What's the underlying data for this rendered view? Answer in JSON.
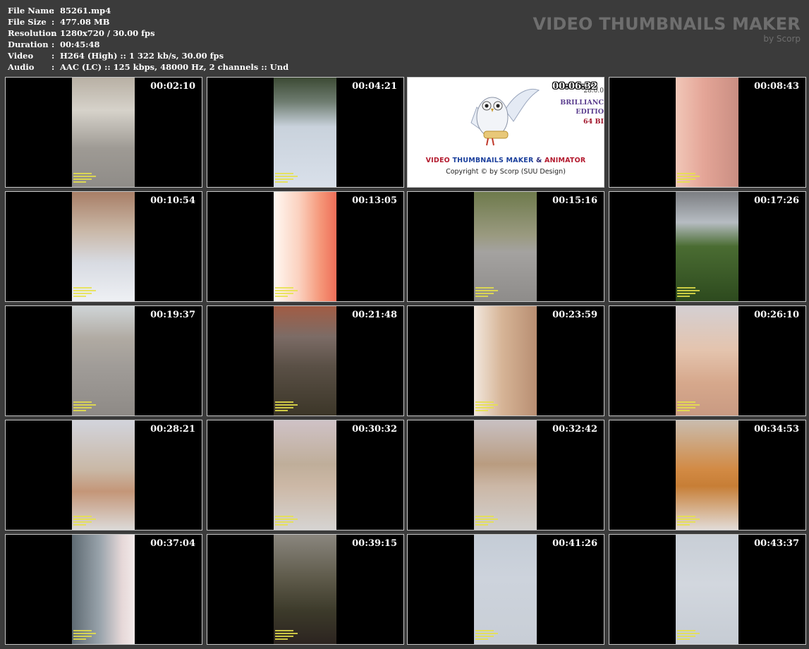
{
  "file_info": {
    "rows": [
      {
        "key": "File Name",
        "sep": ":",
        "value": "85261.mp4"
      },
      {
        "key": "File Size",
        "sep": ":",
        "value": "477.08 MB"
      },
      {
        "key": "Resolution",
        "sep": ":",
        "value": "1280x720 / 30.00 fps"
      },
      {
        "key": "Duration",
        "sep": ":",
        "value": "00:45:48"
      },
      {
        "key": "Video",
        "sep": ":",
        "value": "H264 (High) :: 1 322 kb/s, 30.00 fps"
      },
      {
        "key": "Audio",
        "sep": ":",
        "value": "AAC (LC) :: 125 kbps, 48000 Hz, 2 channels :: Und"
      }
    ]
  },
  "brand": {
    "title": "VIDEO THUMBNAILS MAKER",
    "subtitle": "by Scorp"
  },
  "splash": {
    "title_a": "VIDEO ",
    "title_b": "THUMBNAILS MAKER",
    "title_c": " & ",
    "title_d": "ANIMATOR",
    "copyright": "Copyright © by Scorp (SUU Design)",
    "version": "28.0.0",
    "edition_1": "BRILLIANC",
    "edition_2": "EDITIO",
    "edition_3": "64 BI"
  },
  "thumbnails": [
    {
      "time": "00:02:10",
      "bg": "linear-gradient(180deg,#b8b0a4 0%,#d6d2ca 30%,#9e9a94 65%,#8f8c88 100%)"
    },
    {
      "time": "00:04:21",
      "bg": "linear-gradient(180deg,#3c4a34 0%,#6e7c70 22%,#c9d2dc 45%,#d9e0ea 100%)"
    },
    {
      "time": "00:06:32",
      "splash": true
    },
    {
      "time": "00:08:43",
      "bg": "linear-gradient(90deg,#f1c7b8 0%,#e4a597 45%,#c98e82 100%)"
    },
    {
      "time": "00:10:54",
      "bg": "linear-gradient(180deg,#a87e66 0%,#c9b7a6 35%,#d8dbe2 65%,#eef0f4 100%)"
    },
    {
      "time": "00:13:05",
      "bg": "linear-gradient(90deg,#fff8f2 0%,#fbd2c0 40%,#f59678 75%,#ee6e58 100%)"
    },
    {
      "time": "00:15:16",
      "bg": "linear-gradient(180deg,#6e7a4c 0%,#9a9a80 40%,#a4a2a0 55%,#8e8c8a 100%)"
    },
    {
      "time": "00:17:26",
      "bg": "linear-gradient(180deg,#7c7e82 0%,#b6bcc2 28%,#4a6c32 50%,#2d4a1e 100%)"
    },
    {
      "time": "00:19:37",
      "bg": "linear-gradient(180deg,#cfd4d6 0%,#b0aaa2 30%,#a09c98 55%,#8e8a86 100%)"
    },
    {
      "time": "00:21:48",
      "bg": "linear-gradient(180deg,#a25c44 0%,#7c6c66 28%,#5a5046 55%,#3c3628 100%)"
    },
    {
      "time": "00:23:59",
      "bg": "linear-gradient(90deg,#f2e8de 0%,#d6b496 45%,#b88e72 100%)"
    },
    {
      "time": "00:26:10",
      "bg": "linear-gradient(180deg,#d4cfd2 0%,#e4c4ae 40%,#d6a88c 70%,#c99a82 100%)"
    },
    {
      "time": "00:28:21",
      "bg": "linear-gradient(180deg,#d2d4dc 0%,#c9b8a6 45%,#c49678 65%,#dcdad8 100%)"
    },
    {
      "time": "00:30:32",
      "bg": "linear-gradient(180deg,#cfc2c6 0%,#bfae9a 40%,#ccb8a6 60%,#d6d4d2 100%)"
    },
    {
      "time": "00:32:42",
      "bg": "linear-gradient(180deg,#c8c0c2 0%,#b99c80 40%,#cbb7a6 60%,#d2d0ce 100%)"
    },
    {
      "time": "00:34:53",
      "bg": "linear-gradient(180deg,#c9bcae 0%,#d28a44 45%,#c77e36 60%,#e2dcd8 100%)"
    },
    {
      "time": "00:37:04",
      "bg": "linear-gradient(90deg,#5e6a72 0%,#9aa4ac 45%,#e6d8d8 80%,#f2eaea 100%)"
    },
    {
      "time": "00:39:15",
      "bg": "linear-gradient(180deg,#8a867e 0%,#5e5a4a 40%,#3c3a2a 70%,#2c2420 100%)"
    },
    {
      "time": "00:41:26",
      "bg": "linear-gradient(180deg,#c4ccd6 0%,#cdd3dc 40%,#c8ced6 100%)"
    },
    {
      "time": "00:43:37",
      "bg": "linear-gradient(180deg,#c8ced6 0%,#d2d7de 45%,#c6ccd4 100%)"
    }
  ]
}
